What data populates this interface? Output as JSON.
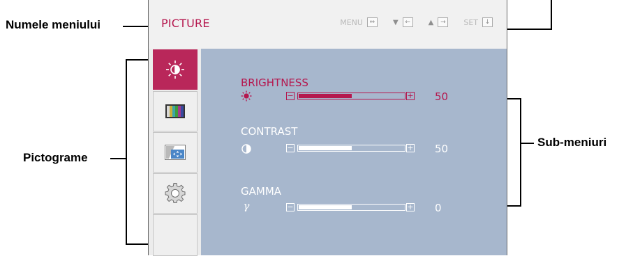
{
  "annotations": {
    "menu_name": "Numele meniului",
    "icons": "Pictograme",
    "submenus": "Sub-meniuri"
  },
  "header": {
    "title": "PICTURE",
    "controls": {
      "menu": "MENU",
      "set": "SET"
    }
  },
  "icons": [
    {
      "name": "picture-brightness-icon",
      "selected": true
    },
    {
      "name": "color-bars-icon",
      "selected": false
    },
    {
      "name": "screen-position-icon",
      "selected": false
    },
    {
      "name": "settings-gear-icon",
      "selected": false
    }
  ],
  "submenu": {
    "items": [
      {
        "label": "BRIGHTNESS",
        "value": "50",
        "level": 50,
        "icon": "sun-icon",
        "active": true
      },
      {
        "label": "CONTRAST",
        "value": "50",
        "level": 50,
        "icon": "contrast-icon",
        "active": false
      },
      {
        "label": "GAMMA",
        "value": "0",
        "level": 50,
        "icon": "gamma-icon",
        "active": false
      }
    ]
  },
  "colors": {
    "accent": "#b5174e",
    "submenu_bg": "#a7b7cd",
    "header_bg": "#f1f1f1"
  }
}
